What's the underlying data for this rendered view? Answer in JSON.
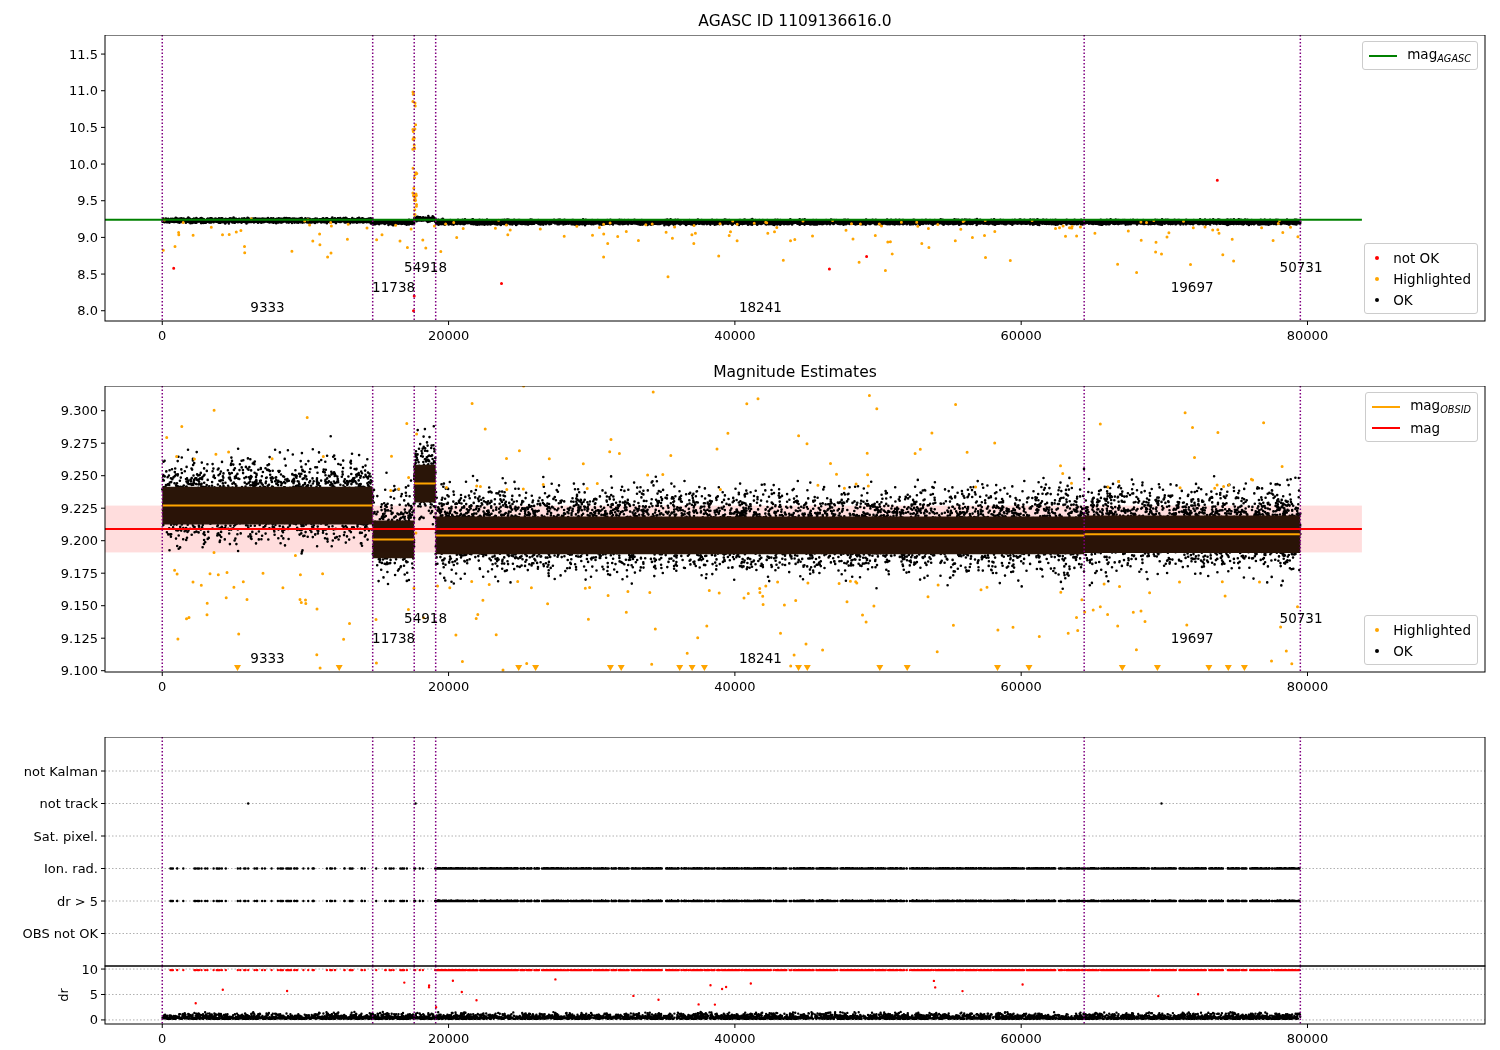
{
  "figure": {
    "panels": [
      {
        "kind": "magnitude",
        "chart_data": {
          "type": "line",
          "title": "AGASC ID 1109136616.0",
          "xlim": [
            -4000,
            92400
          ],
          "ylim": [
            7.86,
            11.76
          ],
          "xticks": [
            0,
            20000,
            40000,
            60000,
            80000
          ],
          "yticks": [
            {
              "value": 8,
              "label": "8.0"
            },
            {
              "value": 8.5,
              "label": "8.5"
            },
            {
              "value": 9,
              "label": "9.0"
            },
            {
              "value": 9.5,
              "label": "9.5"
            },
            {
              "value": 10,
              "label": "10.0"
            },
            {
              "value": 10.5,
              "label": "10.5"
            },
            {
              "value": 11,
              "label": "11.0"
            },
            {
              "value": 11.5,
              "label": "11.5"
            }
          ],
          "series": [
            {
              "name": "mag$_{AGASC}$",
              "color": "#008000",
              "x": [
                -4000,
                83800
              ],
              "values": [
                9.24,
                9.24
              ]
            }
          ],
          "ref_lines": [
            {
              "axis": "x",
              "value": 0,
              "color": "#800080"
            },
            {
              "axis": "x",
              "value": 14700,
              "color": "#800080"
            },
            {
              "axis": "x",
              "value": 17600,
              "color": "#800080"
            },
            {
              "axis": "x",
              "value": 19100,
              "color": "#800080"
            },
            {
              "axis": "x",
              "value": 64400,
              "color": "#800080"
            },
            {
              "axis": "x",
              "value": 79500,
              "color": "#800080"
            }
          ],
          "annotations": [
            "9333",
            "11738",
            "54918",
            "18241",
            "19697",
            "50731"
          ]
        },
        "legend": [
          {
            "label": "not OK",
            "color": "#ff0000",
            "kind": "marker"
          },
          {
            "label": "Highlighted",
            "color": "#ffa500",
            "kind": "marker"
          },
          {
            "label": "OK",
            "color": "#000000",
            "kind": "marker"
          }
        ]
      },
      {
        "kind": "magnitude",
        "chart_data": {
          "type": "line",
          "title": "Magnitude Estimates",
          "xlim": [
            -4000,
            92400
          ],
          "ylim": [
            9.099,
            9.319
          ],
          "xticks": [
            0,
            20000,
            40000,
            60000,
            80000
          ],
          "yticks": [
            {
              "value": 9.1,
              "label": "9.100"
            },
            {
              "value": 9.125,
              "label": "9.125"
            },
            {
              "value": 9.15,
              "label": "9.150"
            },
            {
              "value": 9.175,
              "label": "9.175"
            },
            {
              "value": 9.2,
              "label": "9.200"
            },
            {
              "value": 9.225,
              "label": "9.225"
            },
            {
              "value": 9.25,
              "label": "9.250"
            },
            {
              "value": 9.275,
              "label": "9.275"
            },
            {
              "value": 9.3,
              "label": "9.300"
            }
          ],
          "series": [
            {
              "name": "mag$_{OBSID}$",
              "color": "#ffa500",
              "x": [
                0,
                14700,
                null,
                14700,
                17600,
                null,
                17600,
                19100,
                null,
                19100,
                64400,
                null,
                64400,
                79500
              ],
              "values": [
                9.227,
                9.227,
                null,
                9.201,
                9.201,
                null,
                9.244,
                9.244,
                null,
                9.204,
                9.204,
                null,
                9.205,
                9.205
              ]
            },
            {
              "name": "mag",
              "color": "#ff0000",
              "x": [
                -4000,
                83800
              ],
              "values": [
                9.209,
                9.209
              ]
            }
          ],
          "bands": [
            {
              "axis": "y",
              "from": 9.191,
              "to": 9.227,
              "color": "#ffdddd"
            }
          ],
          "ref_lines": [
            {
              "axis": "x",
              "value": 0,
              "color": "#800080"
            },
            {
              "axis": "x",
              "value": 14700,
              "color": "#800080"
            },
            {
              "axis": "x",
              "value": 17600,
              "color": "#800080"
            },
            {
              "axis": "x",
              "value": 19100,
              "color": "#800080"
            },
            {
              "axis": "x",
              "value": 64400,
              "color": "#800080"
            },
            {
              "axis": "x",
              "value": 79500,
              "color": "#800080"
            }
          ],
          "annotations": [
            "9333",
            "11738",
            "54918",
            "18241",
            "19697",
            "50731"
          ]
        },
        "legend": [
          {
            "label": "Highlighted",
            "color": "#ffa500",
            "kind": "marker"
          },
          {
            "label": "OK",
            "color": "#000000",
            "kind": "marker"
          }
        ]
      },
      {
        "kind": "flags",
        "flags_chart": {
          "chart_data": {
            "type": "scatter",
            "orientation": "horizontal",
            "grid": true,
            "xlim": [
              -4000,
              92400
            ],
            "categories": [
              "not Kalman",
              "not track",
              "Sat. pixel.",
              "Ion. rad.",
              "dr > 5",
              "OBS not OK"
            ],
            "ref_lines": [
              {
                "axis": "x",
                "value": 0,
                "color": "#800080"
              },
              {
                "axis": "x",
                "value": 14700,
                "color": "#800080"
              },
              {
                "axis": "x",
                "value": 17600,
                "color": "#800080"
              },
              {
                "axis": "x",
                "value": 19100,
                "color": "#800080"
              },
              {
                "axis": "x",
                "value": 64400,
                "color": "#800080"
              },
              {
                "axis": "x",
                "value": 79500,
                "color": "#800080"
              }
            ]
          }
        },
        "dr_chart": {
          "chart_data": {
            "type": "scatter",
            "grid": true,
            "ylabel": "dr",
            "xlim": [
              -4000,
              92400
            ],
            "ylim": [
              -0.8,
              10.6
            ],
            "xticks": [
              0,
              20000,
              40000,
              60000,
              80000
            ],
            "yticks": [
              0,
              5,
              10
            ],
            "ref_lines": [
              {
                "axis": "x",
                "value": 0,
                "color": "#800080"
              },
              {
                "axis": "x",
                "value": 14700,
                "color": "#800080"
              },
              {
                "axis": "x",
                "value": 17600,
                "color": "#800080"
              },
              {
                "axis": "x",
                "value": 19100,
                "color": "#800080"
              },
              {
                "axis": "x",
                "value": 64400,
                "color": "#800080"
              },
              {
                "axis": "x",
                "value": 79500,
                "color": "#800080"
              }
            ]
          }
        }
      }
    ]
  }
}
